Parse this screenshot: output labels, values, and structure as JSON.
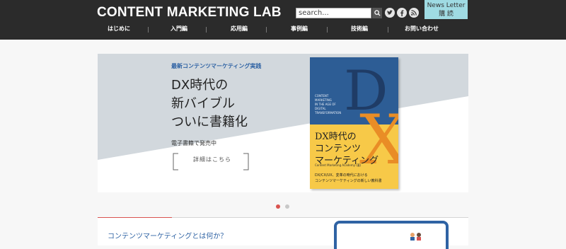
{
  "header": {
    "logo": "CONTENT MARKETING LAB",
    "search": {
      "value": "search..."
    },
    "newsletter_lines": [
      "News Letter",
      "購 読"
    ]
  },
  "nav": {
    "items": [
      "はじめに",
      "入門編",
      "応用編",
      "事例編",
      "技術編",
      "お問い合わせ"
    ]
  },
  "banner": {
    "eyebrow": "最新コンテンツマーケティング実践",
    "headline_lines": [
      "DX時代の",
      "新バイブル",
      "ついに書籍化"
    ],
    "ebook_note": "電子書籍で発売中",
    "detail_button": "詳細はこちら",
    "book": {
      "letters": "DX",
      "english_lines": "CONTENT\nMARKETING\nIN THE AGE OF\nDIGITAL\nTRANSFORMATION",
      "title_lines": "DX時代の\nコンテンツ\nマーケティング",
      "author": "Content Marketing Academy (著)",
      "subtitle_lines": "DX/CX/UX、変革の時代における\nコンテンツマーケティングの新しい教科書"
    },
    "colors": {
      "book_top": "#2d5d95",
      "book_bottom": "#f7c948",
      "accent_x": "#e98d26"
    }
  },
  "carousel": {
    "slides": 2,
    "active": 1,
    "active_color": "#d9534f",
    "inactive_color": "#c8c8c8"
  },
  "section": {
    "title": "コンテンツマーケティングとは何か？"
  }
}
